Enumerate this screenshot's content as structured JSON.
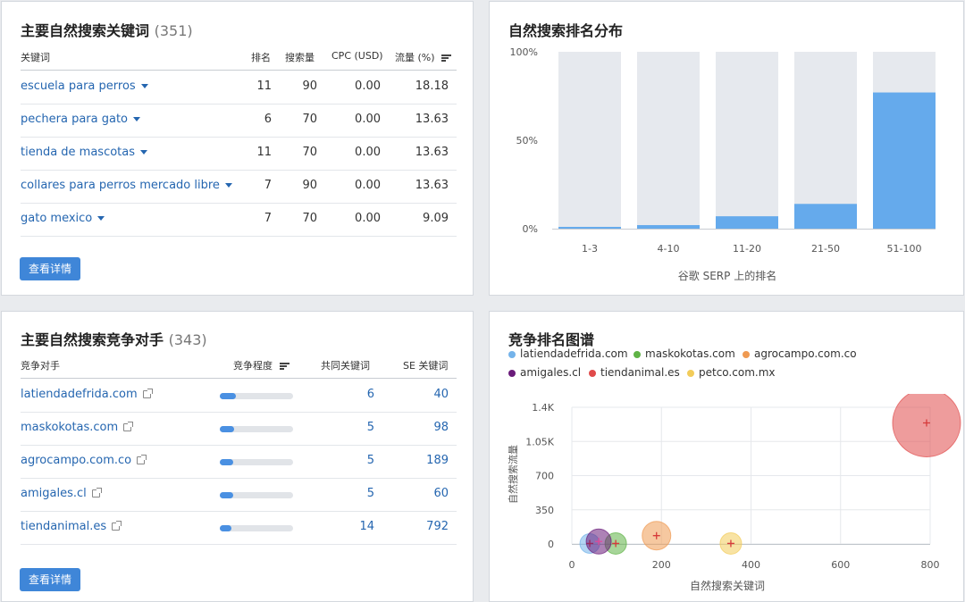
{
  "keywords_card": {
    "title": "主要自然搜索关键词",
    "count": "(351)",
    "headers": {
      "keyword": "关键词",
      "rank": "排名",
      "volume": "搜索量",
      "cpc": "CPC (USD)",
      "traffic": "流量 (%)"
    },
    "rows": [
      {
        "keyword": "escuela para perros",
        "rank": "11",
        "volume": "90",
        "cpc": "0.00",
        "traffic": "18.18"
      },
      {
        "keyword": "pechera para gato",
        "rank": "6",
        "volume": "70",
        "cpc": "0.00",
        "traffic": "13.63"
      },
      {
        "keyword": "tienda de mascotas",
        "rank": "11",
        "volume": "70",
        "cpc": "0.00",
        "traffic": "13.63"
      },
      {
        "keyword": "collares para perros mercado libre",
        "rank": "7",
        "volume": "90",
        "cpc": "0.00",
        "traffic": "13.63"
      },
      {
        "keyword": "gato mexico",
        "rank": "7",
        "volume": "70",
        "cpc": "0.00",
        "traffic": "9.09"
      }
    ],
    "button": "查看详情"
  },
  "distribution_card": {
    "title": "自然搜索排名分布",
    "xlabel": "谷歌 SERP 上的排名",
    "chart_data": {
      "type": "bar",
      "categories": [
        "1-3",
        "4-10",
        "11-20",
        "21-50",
        "51-100"
      ],
      "values": [
        1,
        2,
        7,
        14,
        77
      ],
      "ylim": [
        0,
        100
      ],
      "yticks": [
        "0%",
        "50%",
        "100%"
      ],
      "xlabel": "谷歌 SERP 上的排名",
      "bar_color": "#65aaec",
      "track_color": "#e6e9ee"
    }
  },
  "competitors_card": {
    "title": "主要自然搜索竞争对手",
    "count": "(343)",
    "headers": {
      "competitor": "竞争对手",
      "level": "竞争程度",
      "common": "共同关键词",
      "se": "SE 关键词"
    },
    "rows": [
      {
        "domain": "latiendadefrida.com",
        "level": 0.22,
        "common": "6",
        "se": "40"
      },
      {
        "domain": "maskokotas.com",
        "level": 0.19,
        "common": "5",
        "se": "98"
      },
      {
        "domain": "agrocampo.com.co",
        "level": 0.18,
        "common": "5",
        "se": "189"
      },
      {
        "domain": "amigales.cl",
        "level": 0.18,
        "common": "5",
        "se": "60"
      },
      {
        "domain": "tiendanimal.es",
        "level": 0.16,
        "common": "14",
        "se": "792"
      }
    ],
    "button": "查看详情"
  },
  "map_card": {
    "title": "竞争排名图谱",
    "legend": [
      {
        "name": "latiendadefrida.com",
        "color": "#74b3ea"
      },
      {
        "name": "maskokotas.com",
        "color": "#5fb346"
      },
      {
        "name": "agrocampo.com.co",
        "color": "#ef9a52"
      },
      {
        "name": "amigales.cl",
        "color": "#6a1b7a"
      },
      {
        "name": "tiendanimal.es",
        "color": "#e04a4a"
      },
      {
        "name": "petco.com.mx",
        "color": "#f2cc5a"
      }
    ],
    "chart_data": {
      "type": "scatter",
      "xlabel": "自然搜索关键词",
      "ylabel": "自然搜索流量",
      "xlim": [
        0,
        800
      ],
      "ylim": [
        0,
        1400
      ],
      "xticks": [
        "0",
        "200",
        "400",
        "600",
        "800"
      ],
      "yticks": [
        "0",
        "350",
        "700",
        "1.05K",
        "1.4K"
      ],
      "series": [
        {
          "name": "latiendadefrida.com",
          "x": 40,
          "y": 5,
          "size": 11
        },
        {
          "name": "maskokotas.com",
          "x": 98,
          "y": 5,
          "size": 12
        },
        {
          "name": "agrocampo.com.co",
          "x": 189,
          "y": 85,
          "size": 16
        },
        {
          "name": "amigales.cl",
          "x": 60,
          "y": 25,
          "size": 14
        },
        {
          "name": "tiendanimal.es",
          "x": 792,
          "y": 1240,
          "size": 38
        },
        {
          "name": "petco.com.mx",
          "x": 355,
          "y": 5,
          "size": 12
        }
      ]
    }
  }
}
